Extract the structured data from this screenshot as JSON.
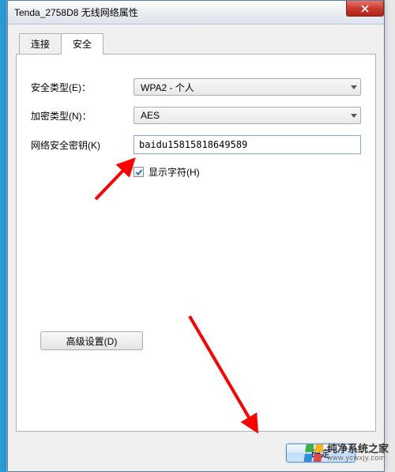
{
  "window": {
    "title": "Tenda_2758D8 无线网络属性"
  },
  "tabs": {
    "connect": "连接",
    "security": "安全"
  },
  "form": {
    "security_type_label": "安全类型(E)：",
    "security_type_value": "WPA2 - 个人",
    "encryption_label": "加密类型(N)：",
    "encryption_value": "AES",
    "key_label": "网络安全密钥(K)",
    "key_value": "baidu15815818649589",
    "show_chars_label": "显示字符(H)"
  },
  "buttons": {
    "advanced": "高级设置(D)",
    "ok": "确定"
  },
  "watermark": {
    "name": "纯净系统之家",
    "url": "www.ycwxjy.com",
    "colors": {
      "tl": "#3bb04a",
      "tr": "#f5b516",
      "bl": "#2e8fd8",
      "br": "#e04848"
    }
  }
}
